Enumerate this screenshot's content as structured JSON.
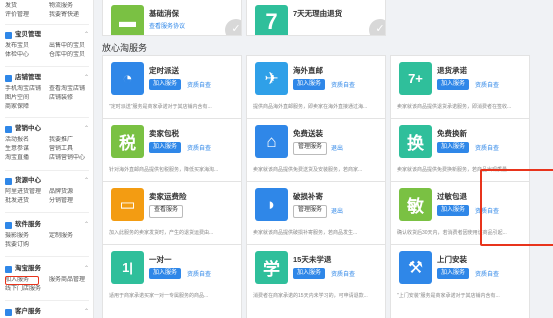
{
  "sidebar": {
    "top_links": [
      [
        "发货",
        "物流服务"
      ],
      [
        "评价管理",
        "我要寄快递"
      ]
    ],
    "sections": [
      {
        "title": "宝贝管理",
        "links": [
          [
            "发布宝贝",
            "出售中的宝贝"
          ],
          [
            "体检中心",
            "仓库中的宝贝"
          ]
        ]
      },
      {
        "title": "店铺管理",
        "links": [
          [
            "手机淘宝店铺",
            "查看淘宝店铺"
          ],
          [
            "图片空间",
            "店铺装修"
          ],
          [
            "商家保障",
            ""
          ]
        ]
      },
      {
        "title": "营销中心",
        "links": [
          [
            "活动报名",
            "我要推广"
          ],
          [
            "生意参谋",
            "营销工具"
          ],
          [
            "淘宝直播",
            "店铺营销中心"
          ]
        ]
      },
      {
        "title": "货源中心",
        "links": [
          [
            "阿里进货管理",
            "品牌货源"
          ],
          [
            "批发进货",
            "分销管理"
          ]
        ]
      },
      {
        "title": "软件服务",
        "links": [
          [
            "摄影服务",
            "定制服务"
          ],
          [
            "我要订购",
            ""
          ]
        ]
      },
      {
        "title": "淘宝服务",
        "links": [
          [
            "加入服务",
            "服务商品管理"
          ],
          [
            "线下门店服务",
            ""
          ]
        ]
      },
      {
        "title": "客户服务",
        "links": []
      }
    ]
  },
  "main": {
    "section_title": "放心淘服务",
    "top_cards": [
      {
        "name": "基础消保",
        "link": "查看服务协议",
        "icon": "wallet-icon",
        "color": "#7ac143",
        "glyph": "▬"
      },
      {
        "name": "7天无理由退货",
        "icon": "seven-icon",
        "color": "#2fbf9b",
        "glyph": "7"
      }
    ],
    "cards": [
      {
        "name": "定时派送",
        "btn": "加入服务",
        "btn_type": "primary",
        "link": "资质自查",
        "desc": "\"定时派送\"服务是商家承诺对于其店铺内含有...",
        "icon": "clock-icon",
        "color": "#2f87e8",
        "glyph": "◔"
      },
      {
        "name": "海外直邮",
        "btn": "加入服务",
        "btn_type": "primary",
        "link": "资质自查",
        "desc": "提供商品海外直邮服务，即卖家在海外直接通过海...",
        "icon": "plane-icon",
        "color": "#2fa0e8",
        "glyph": "✈"
      },
      {
        "name": "退货承诺",
        "btn": "加入服务",
        "btn_type": "primary",
        "link": "资质自查",
        "desc": "卖家就该商品提供退货承诺服务，即消费者在签收...",
        "icon": "return-icon",
        "color": "#2fbf9b",
        "glyph": "7+"
      },
      {
        "name": "卖家包税",
        "btn": "加入服务",
        "btn_type": "primary",
        "link": "资质自查",
        "desc": "针对海外直邮商品提供包税服务，降低买家海淘...",
        "icon": "tax-icon",
        "color": "#7ac143",
        "glyph": "税"
      },
      {
        "name": "免费送装",
        "btn": "管理服务",
        "btn_type": "outline",
        "link": "退出",
        "desc": "卖家就该商品提供免费送货及安装服务，若商家...",
        "icon": "install-icon",
        "color": "#2f87e8",
        "glyph": "⌂",
        "checked": true
      },
      {
        "name": "免费换新",
        "btn": "加入服务",
        "btn_type": "primary",
        "link": "资质自查",
        "desc": "卖家就该商品提供免费换新服务，若商品出现质量...",
        "icon": "exchange-icon",
        "color": "#2fbf9b",
        "glyph": "换"
      },
      {
        "name": "卖家运费险",
        "btn": "查看服务",
        "btn_type": "outline",
        "link": "",
        "desc": "加入此服务的卖家发货时，产生的退货运费由...",
        "icon": "truck-icon",
        "color": "#f39c12",
        "glyph": "▭"
      },
      {
        "name": "破损补寄",
        "btn": "管理服务",
        "btn_type": "outline",
        "link": "退出",
        "desc": "卖家就该商品提供破损补寄服务，若商品发生...",
        "icon": "shield-icon",
        "color": "#2f87e8",
        "glyph": "◗",
        "checked": true
      },
      {
        "name": "过敏包退",
        "btn": "加入服务",
        "btn_type": "primary",
        "link": "资质自查",
        "desc": "确认收货后30天内，若消费者因使用该商品引起...",
        "icon": "allergy-icon",
        "color": "#7ac143",
        "glyph": "敏"
      },
      {
        "name": "一对一",
        "btn": "加入服务",
        "btn_type": "primary",
        "link": "资质自查",
        "desc": "适用于商家承诺买家一对一专属服务的商品...",
        "icon": "oneone-icon",
        "color": "#2fbf9b",
        "glyph": "1|"
      },
      {
        "name": "15天未学退",
        "btn": "加入服务",
        "btn_type": "primary",
        "link": "资质自查",
        "desc": "消费者在商家承诺的15天内未学习的，可申请退款...",
        "icon": "study-icon",
        "color": "#2fbf9b",
        "glyph": "学"
      },
      {
        "name": "上门安装",
        "btn": "加入服务",
        "btn_type": "primary",
        "link": "资质自查",
        "desc": "\"上门安装\"服务是商家承诺对于其店铺内含有...",
        "icon": "tools-icon",
        "color": "#2f87e8",
        "glyph": "⚒"
      }
    ]
  }
}
